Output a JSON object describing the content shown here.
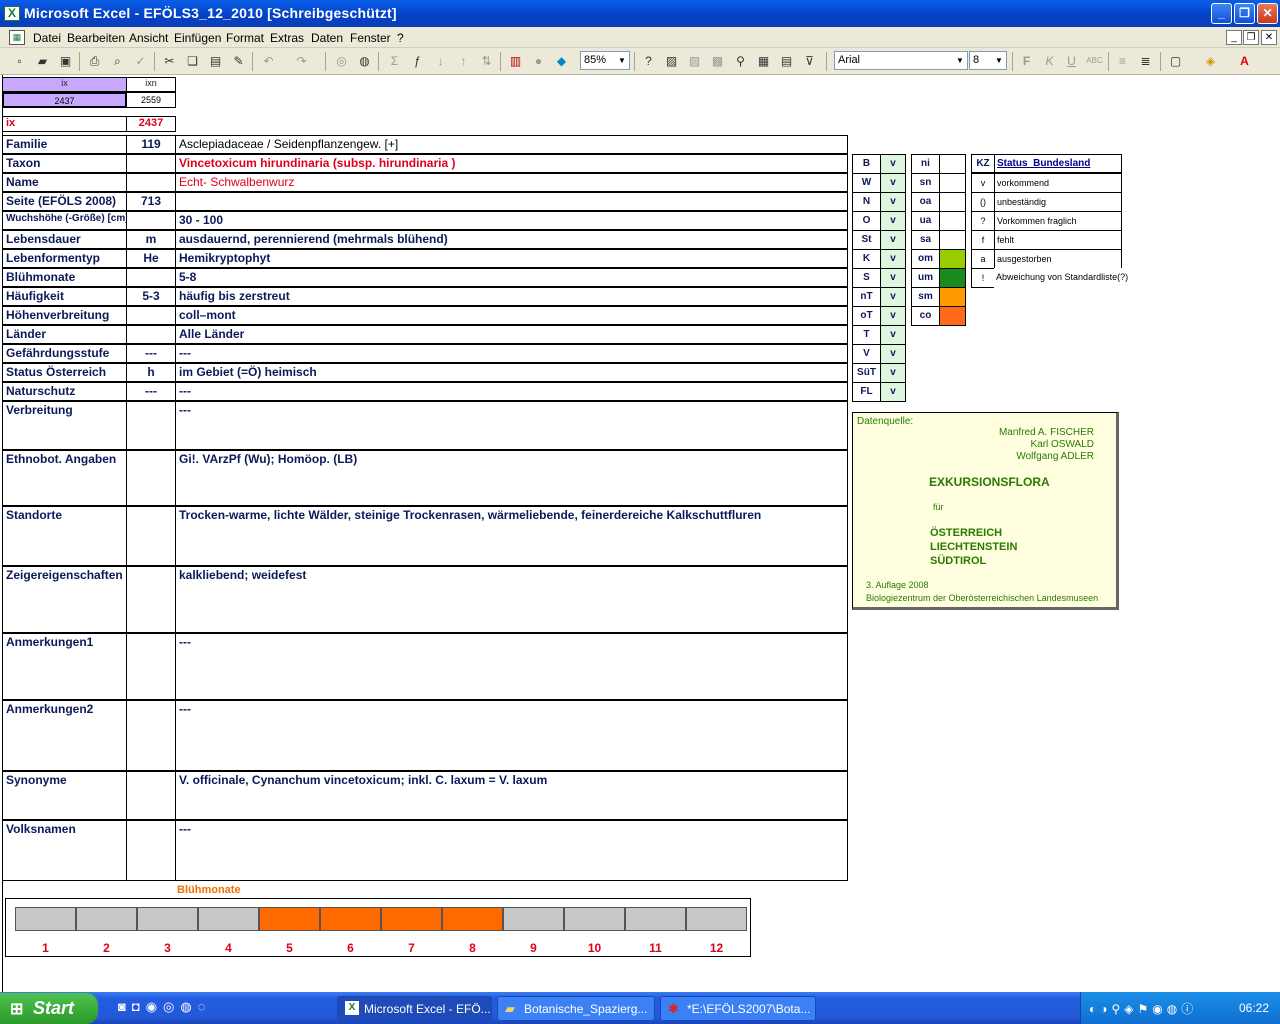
{
  "window": {
    "title": "Microsoft Excel - EFÖLS3_12_2010  [Schreibgeschützt]"
  },
  "menu": [
    "Datei",
    "Bearbeiten",
    "Ansicht",
    "Einfügen",
    "Format",
    "Extras",
    "Daten",
    "Fenster",
    "?"
  ],
  "toolbar": {
    "zoom": "85%",
    "font": "Arial",
    "size": "8"
  },
  "top": {
    "ix_hdr": "ix",
    "ixn_hdr": "ixn",
    "ix_val": "2437",
    "ixn_val": "2559",
    "ix_label": "ix",
    "ix_red": "2437"
  },
  "rows": [
    {
      "label": "Familie",
      "code": "119",
      "value": "Asclepiadaceae  /  Seidenpflanzengew. [+]"
    },
    {
      "label": "Taxon",
      "code": "",
      "value": "Vincetoxicum hirundinaria (subsp. hirundinaria )"
    },
    {
      "label": "Name",
      "code": "",
      "value": "Echt- Schwalbenwurz"
    },
    {
      "label": "Seite (EFÖLS 2008)",
      "code": "713",
      "value": ""
    },
    {
      "label": "Wuchshöhe (-Größe) [cm]",
      "code": "",
      "value": " 30 - 100"
    },
    {
      "label": "Lebensdauer",
      "code": "m",
      "value": "ausdauernd, perennierend (mehrmals blühend)"
    },
    {
      "label": "Lebenformentyp",
      "code": "He",
      "value": "Hemikryptophyt"
    },
    {
      "label": "Blühmonate",
      "code": "",
      "value": " 5-8"
    },
    {
      "label": "Häufigkeit",
      "code": "5-3",
      "value": "häufig bis zerstreut"
    },
    {
      "label": "Höhenverbreitung",
      "code": "",
      "value": "coll–mont"
    },
    {
      "label": "Länder",
      "code": "",
      "value": "Alle Länder"
    },
    {
      "label": "Gefährdungsstufe",
      "code": "---",
      "value": "  ---"
    },
    {
      "label": "Status Österreich",
      "code": "h",
      "value": "im Gebiet (=Ö) heimisch"
    },
    {
      "label": "Naturschutz",
      "code": "---",
      "value": " ---"
    },
    {
      "label": "Verbreitung",
      "code": "",
      "value": " ---"
    },
    {
      "label": "Ethnobot. Angaben",
      "code": "",
      "value": "Gi!. VArzPf (Wu); Homöop. (LB)"
    },
    {
      "label": "Standorte",
      "code": "",
      "value": "Trocken-warme, lichte Wälder, steinige Trockenrasen, wärmeliebende, feinerdereiche Kalkschuttfluren"
    },
    {
      "label": "Zeigereigenschaften",
      "code": "",
      "value": " kalkliebend; weidefest"
    },
    {
      "label": "Anmerkungen1",
      "code": "",
      "value": "---"
    },
    {
      "label": "Anmerkungen2",
      "code": "",
      "value": "---"
    },
    {
      "label": "Synonyme",
      "code": "",
      "value": "V. officinale, Cynanchum vincetoxicum; inkl. C. laxum = V. laxum"
    },
    {
      "label": "Volksnamen",
      "code": "",
      "value": "---"
    }
  ],
  "regions": [
    {
      "code": "B",
      "v": "v"
    },
    {
      "code": "W",
      "v": "v"
    },
    {
      "code": "N",
      "v": "v"
    },
    {
      "code": "O",
      "v": "v"
    },
    {
      "code": "St",
      "v": "v"
    },
    {
      "code": "K",
      "v": "v"
    },
    {
      "code": "S",
      "v": "v"
    },
    {
      "code": "nT",
      "v": "v"
    },
    {
      "code": "oT",
      "v": "v"
    },
    {
      "code": "T",
      "v": "v"
    },
    {
      "code": "V",
      "v": "v"
    },
    {
      "code": "SüT",
      "v": "v"
    },
    {
      "code": "FL",
      "v": "v"
    }
  ],
  "status_codes": [
    {
      "code": "ni",
      "color": ""
    },
    {
      "code": "sn",
      "color": ""
    },
    {
      "code": "oa",
      "color": ""
    },
    {
      "code": "ua",
      "color": ""
    },
    {
      "code": "sa",
      "color": ""
    },
    {
      "code": "om",
      "color": "#9acd00"
    },
    {
      "code": "um",
      "color": "#1a8a1a"
    },
    {
      "code": "sm",
      "color": "#ff9a00"
    },
    {
      "code": "co",
      "color": "#ff6a1a"
    }
  ],
  "legend": {
    "header_kz": "KZ",
    "header_status": "Status_Bundesland",
    "items": [
      {
        "kz": "v",
        "text": "vorkommend"
      },
      {
        "kz": "()",
        "text": "unbeständig"
      },
      {
        "kz": "?",
        "text": "Vorkommen fraglich"
      },
      {
        "kz": "f",
        "text": "fehlt"
      },
      {
        "kz": "a",
        "text": "ausgestorben"
      },
      {
        "kz": "!",
        "text": "Abweichung von Standardliste(?)"
      }
    ]
  },
  "source": {
    "label": "Datenquelle:",
    "authors": [
      "Manfred A. FISCHER",
      "Karl OSWALD",
      "Wolfgang ADLER"
    ],
    "title": "EXKURSIONSFLORA",
    "fuer": "für",
    "countries": [
      "ÖSTERREICH",
      "LIECHTENSTEIN",
      "SÜDTIROL"
    ],
    "edition": "3. Auflage 2008",
    "publisher": "Biologiezentrum der Oberösterreichischen Landesmuseen"
  },
  "bloom": {
    "title": "Blühmonate",
    "months": [
      "1",
      "2",
      "3",
      "4",
      "5",
      "6",
      "7",
      "8",
      "9",
      "10",
      "11",
      "12"
    ],
    "active": [
      false,
      false,
      false,
      false,
      true,
      true,
      true,
      true,
      false,
      false,
      false,
      false
    ]
  },
  "taskbar": {
    "start": "Start",
    "tasks": [
      "Microsoft Excel - EFÖ...",
      "Botanische_Spazierg...",
      "*E:\\EFÖLS2007\\Bota..."
    ],
    "clock": "06:22"
  }
}
